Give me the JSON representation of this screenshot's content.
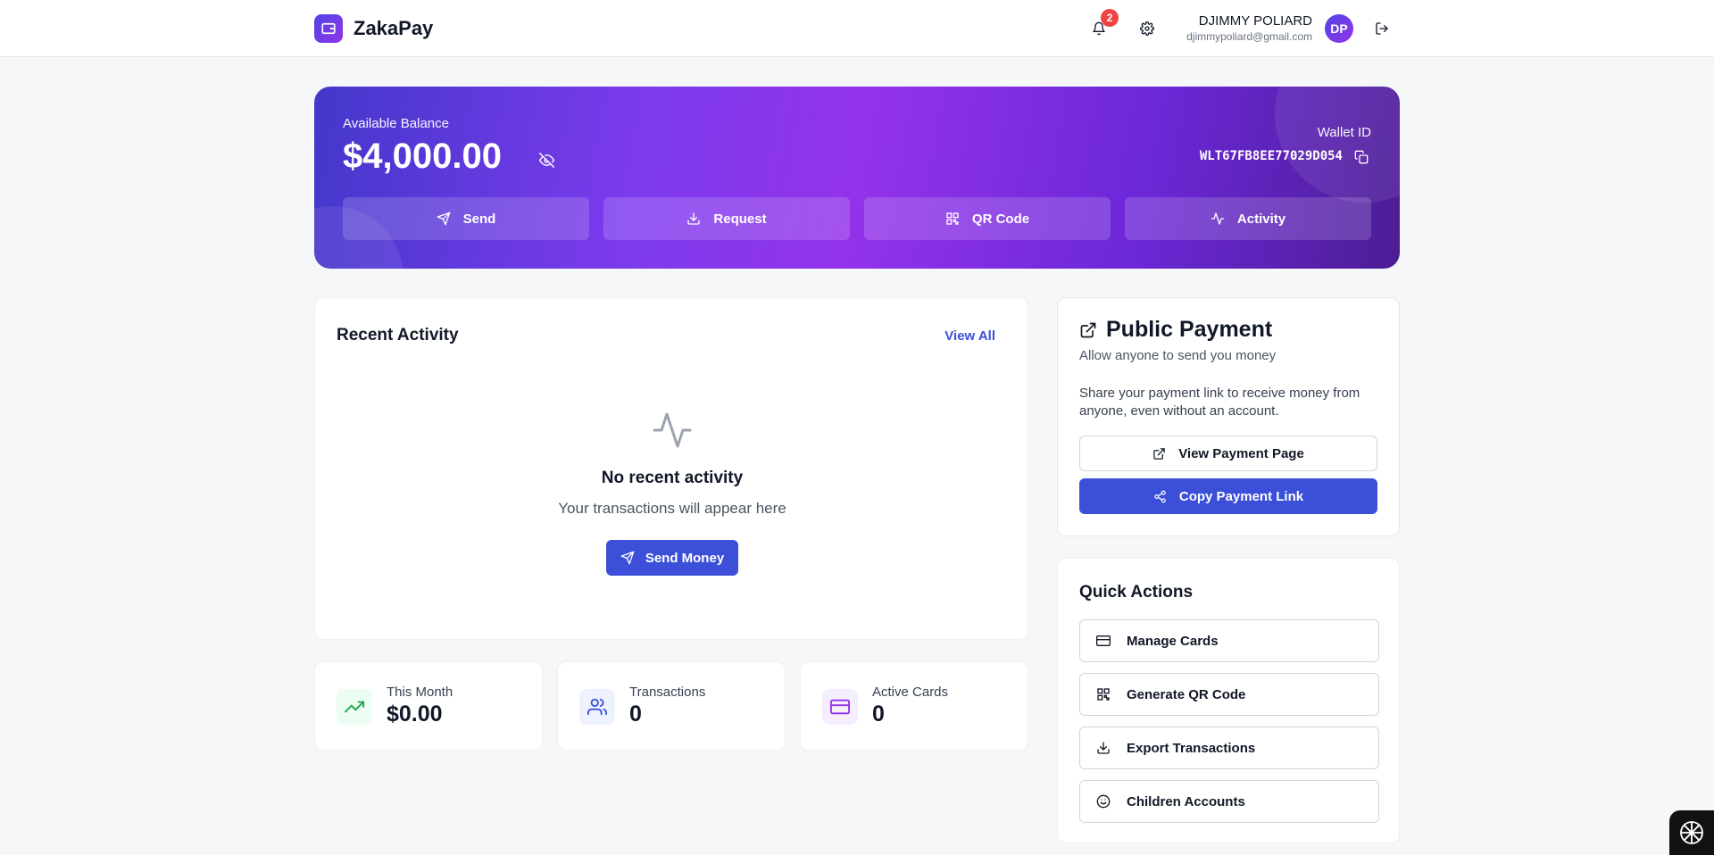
{
  "header": {
    "brand": "ZakaPay",
    "notifications_count": "2",
    "user_name": "DJIMMY POLIARD",
    "user_email": "djimmypoliard@gmail.com",
    "avatar_initials": "DP"
  },
  "balance": {
    "label": "Available Balance",
    "amount": "$4,000.00",
    "wallet_label": "Wallet ID",
    "wallet_id": "WLT67FB8EE77029D054",
    "actions": [
      {
        "label": "Send",
        "icon": "send-icon"
      },
      {
        "label": "Request",
        "icon": "download-icon"
      },
      {
        "label": "QR Code",
        "icon": "qr-code-icon"
      },
      {
        "label": "Activity",
        "icon": "activity-icon"
      }
    ]
  },
  "recent": {
    "title": "Recent Activity",
    "view_all": "View All",
    "empty_title": "No recent activity",
    "empty_sub": "Your transactions will appear here",
    "send_money": "Send Money"
  },
  "stats": [
    {
      "label": "This Month",
      "value": "$0.00",
      "icon": "trending-up-icon",
      "color": "#16a34a",
      "bg": "#ecfdf3"
    },
    {
      "label": "Transactions",
      "value": "0",
      "icon": "users-icon",
      "color": "#3b4fd8",
      "bg": "#eef2ff"
    },
    {
      "label": "Active Cards",
      "value": "0",
      "icon": "credit-card-icon",
      "color": "#9333ea",
      "bg": "#f5eefe"
    }
  ],
  "public_payment": {
    "title": "Public Payment",
    "subtitle": "Allow anyone to send you money",
    "description": "Share your payment link to receive money from anyone, even without an account.",
    "view_page": "View Payment Page",
    "copy_link": "Copy Payment Link"
  },
  "quick_actions": {
    "title": "Quick Actions",
    "items": [
      {
        "label": "Manage Cards",
        "icon": "credit-card-icon"
      },
      {
        "label": "Generate QR Code",
        "icon": "qr-code-icon"
      },
      {
        "label": "Export Transactions",
        "icon": "download-icon"
      },
      {
        "label": "Children Accounts",
        "icon": "smile-icon"
      }
    ]
  },
  "colors": {
    "primary": "#3b4fd8",
    "accent": "#9333ea",
    "badge": "#ef4444"
  }
}
